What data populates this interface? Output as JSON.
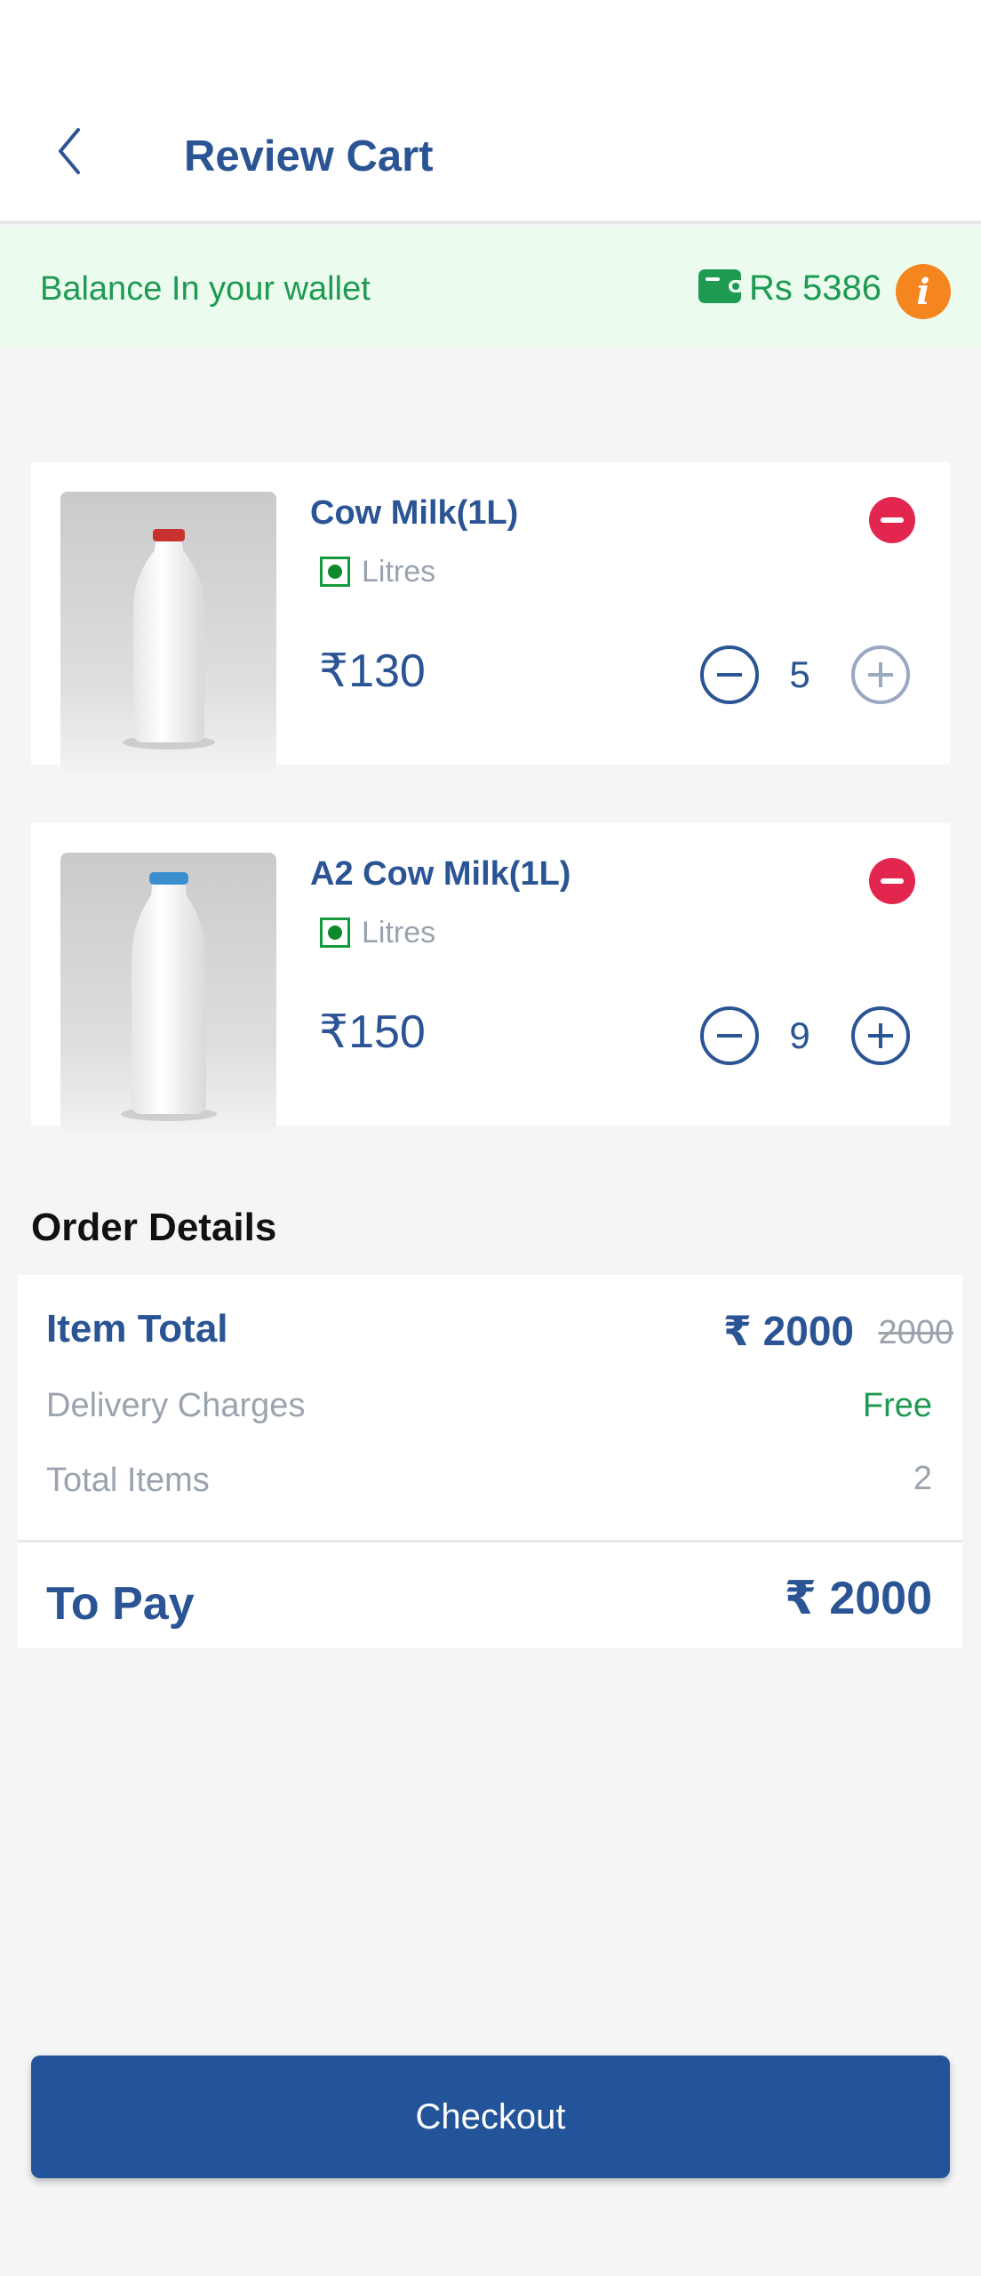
{
  "header": {
    "title": "Review Cart"
  },
  "wallet": {
    "label": "Balance In your wallet",
    "amount": "Rs 5386",
    "info_glyph": "i"
  },
  "cart": {
    "items": [
      {
        "name": "Cow Milk(1L)",
        "unit": "Litres",
        "price": "₹130",
        "quantity": "5",
        "cap_color": "#c8322e"
      },
      {
        "name": "A2 Cow Milk(1L)",
        "unit": "Litres",
        "price": "₹150",
        "quantity": "9",
        "cap_color": "#3b8fcf"
      }
    ]
  },
  "order_details": {
    "title": "Order Details",
    "item_total_label": "Item Total",
    "item_total_value": "₹ 2000",
    "item_total_original": "2000",
    "delivery_label": "Delivery Charges",
    "delivery_value": "Free",
    "total_items_label": "Total Items",
    "total_items_value": "2",
    "to_pay_label": "To Pay",
    "to_pay_value": "₹ 2000"
  },
  "checkout": {
    "label": "Checkout"
  },
  "colors": {
    "brand": "#2a5494",
    "accent_green": "#1f9a52",
    "remove_red": "#e2264d",
    "info_orange": "#f5851f"
  }
}
